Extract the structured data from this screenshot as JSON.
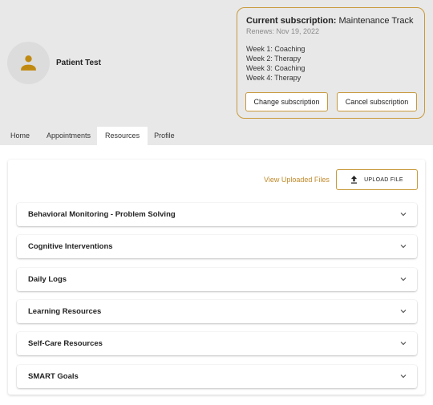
{
  "profile": {
    "name": "Patient Test",
    "avatar_icon": "person-icon",
    "avatar_color": "#c08a12"
  },
  "subscription": {
    "title_label": "Current subscription:",
    "plan_name": "Maintenance Track",
    "renews": "Renews: Nov 19, 2022",
    "weeks": [
      "Week 1: Coaching",
      "Week 2: Therapy",
      "Week 3: Coaching",
      "Week 4: Therapy"
    ],
    "change_label": "Change subscription",
    "cancel_label": "Cancel subscription",
    "accent_color": "#c89a3c"
  },
  "tabs": [
    {
      "label": "Home",
      "active": false
    },
    {
      "label": "Appointments",
      "active": false
    },
    {
      "label": "Resources",
      "active": true
    },
    {
      "label": "Profile",
      "active": false
    }
  ],
  "resources": {
    "view_files_label": "View Uploaded Files",
    "upload_label": "UPLOAD FILE",
    "upload_icon": "upload-icon",
    "sections": [
      {
        "label": "Behavioral Monitoring - Problem Solving",
        "expanded": false
      },
      {
        "label": "Cognitive Interventions",
        "expanded": false
      },
      {
        "label": "Daily Logs",
        "expanded": false
      },
      {
        "label": "Learning Resources",
        "expanded": false
      },
      {
        "label": "Self-Care Resources",
        "expanded": false
      },
      {
        "label": "SMART Goals",
        "expanded": false
      }
    ]
  }
}
